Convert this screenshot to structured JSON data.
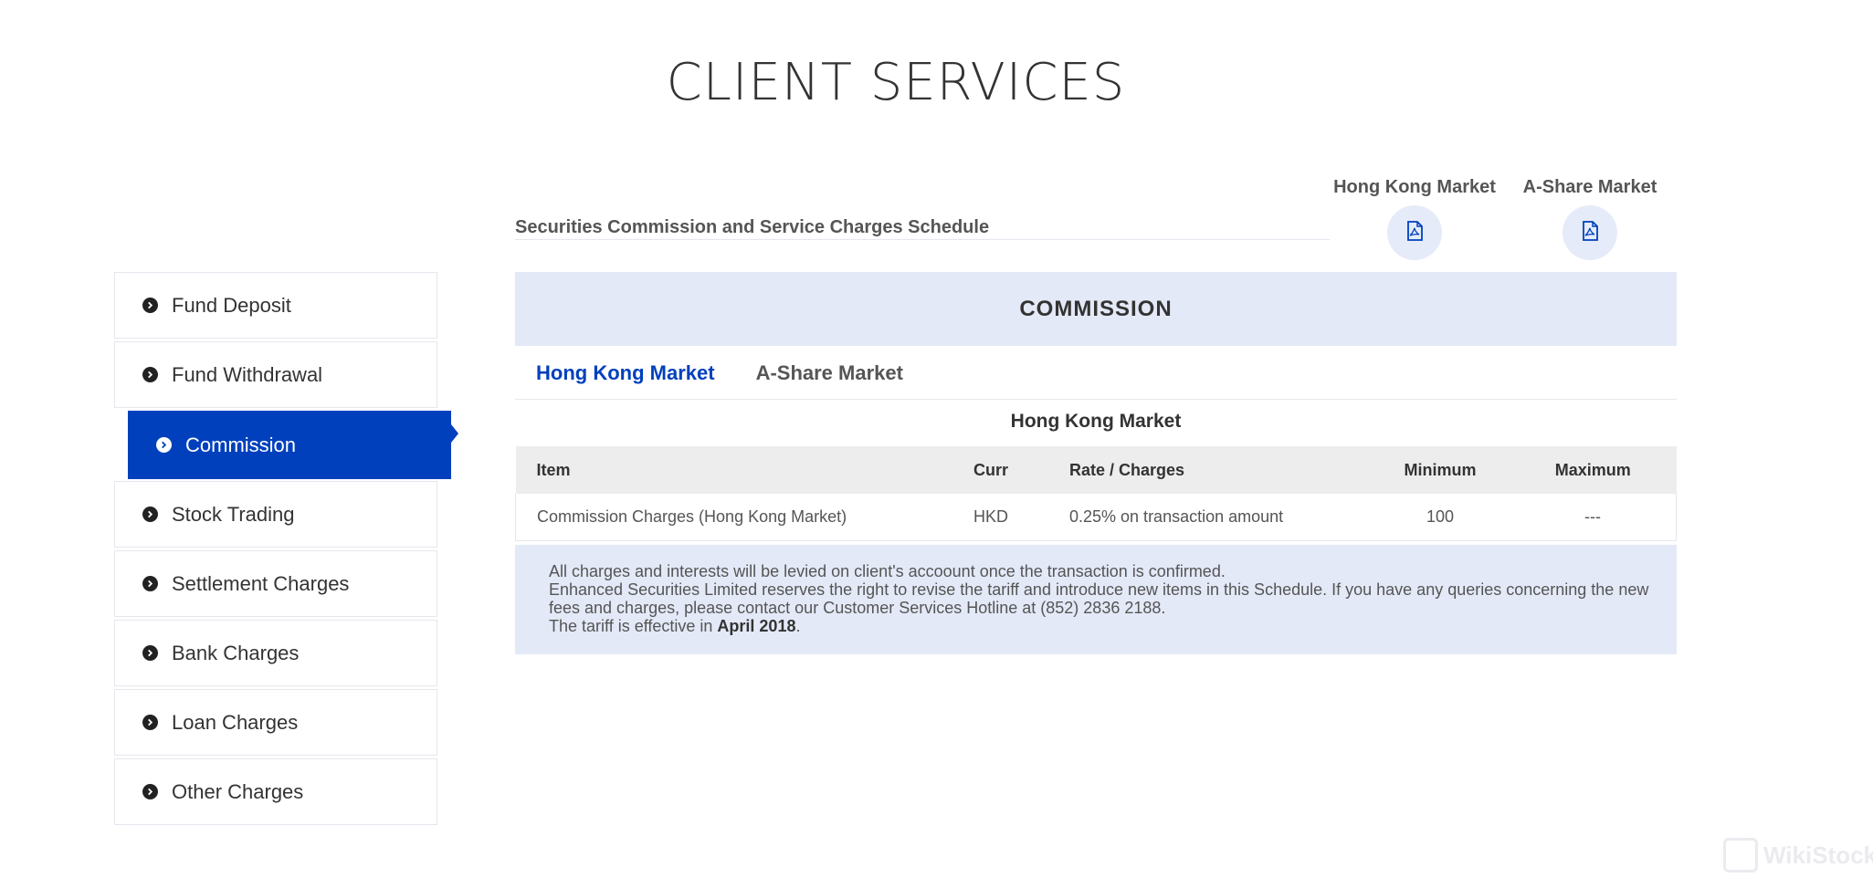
{
  "page": {
    "title": "CLIENT SERVICES"
  },
  "sidebar": {
    "items": [
      {
        "label": "Fund Deposit"
      },
      {
        "label": "Fund Withdrawal"
      },
      {
        "label": "Commission",
        "active": true
      },
      {
        "label": "Stock Trading"
      },
      {
        "label": "Settlement Charges"
      },
      {
        "label": "Bank Charges"
      },
      {
        "label": "Loan Charges"
      },
      {
        "label": "Other Charges"
      }
    ]
  },
  "schedule": {
    "label": "Securities Commission and Service Charges Schedule",
    "downloads": [
      {
        "label": "Hong Kong Market",
        "icon": "pdf-icon"
      },
      {
        "label": "A-Share Market",
        "icon": "pdf-icon"
      }
    ]
  },
  "commission": {
    "banner": "COMMISSION",
    "tabs": [
      {
        "label": "Hong Kong Market",
        "active": true
      },
      {
        "label": "A-Share Market",
        "active": false
      }
    ],
    "market_title": "Hong Kong Market",
    "table": {
      "headers": [
        "Item",
        "Curr",
        "Rate / Charges",
        "Minimum",
        "Maximum"
      ],
      "rows": [
        [
          "Commission Charges (Hong Kong Market)",
          "HKD",
          "0.25% on transaction amount",
          "100",
          "---"
        ]
      ]
    },
    "notes": {
      "line1": "All charges and interests will be levied on client's accoount once the transaction is confirmed.",
      "line2": "Enhanced Securities Limited reserves the right to revise the tariff and introduce new items in this Schedule. If you have any queries concerning the new fees and charges, please contact our Customer Services Hotline at (852) 2836 2188.",
      "line3_prefix": "The tariff is effective in ",
      "line3_bold": "April 2018",
      "line3_suffix": "."
    }
  },
  "watermark": {
    "text": "WikiStock"
  },
  "colors": {
    "accent": "#0040bd",
    "panel": "#e3e9f7",
    "table_header": "#ededed"
  }
}
